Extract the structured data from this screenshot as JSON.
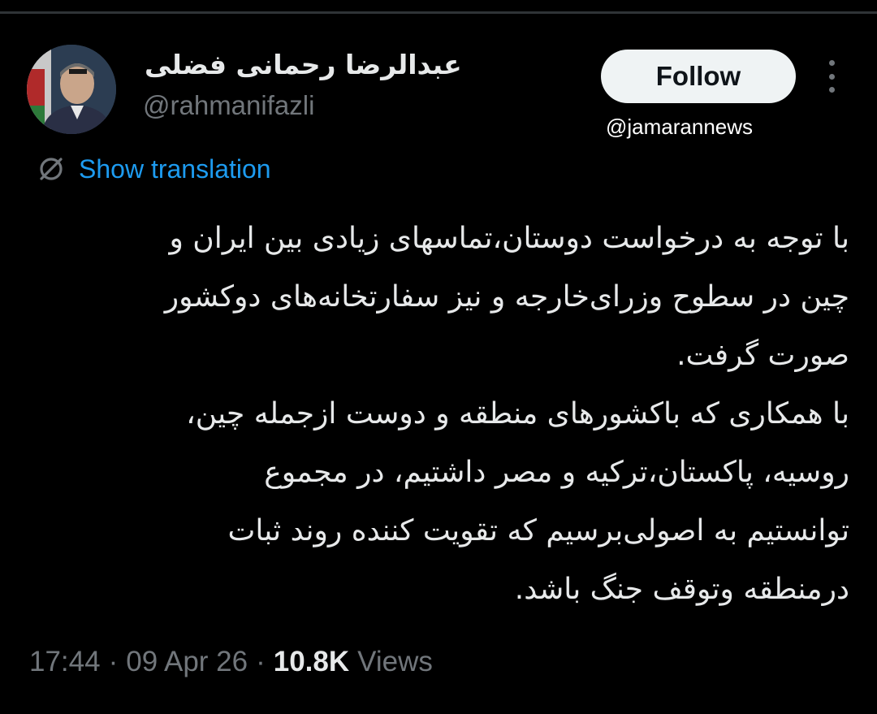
{
  "author": {
    "display_name": "عبدالرضا رحمانی فضلی",
    "handle": "@rahmanifazli"
  },
  "actions": {
    "follow_label": "Follow",
    "more_icon": "more-vertical-icon"
  },
  "watermark": "@jamarannews",
  "translation": {
    "icon": "globe-icon",
    "label": "Show translation"
  },
  "tweet": {
    "lines": [
      "با توجه به درخواست دوستان،تماسهای زیادی بین ایران و",
      "چین در سطوح وزرای‌خارجه و نیز سفارتخانه‌های دوکشور",
      "صورت گرفت.",
      "با همکاری که باکشورهای منطقه و دوست ازجمله چین،",
      "روسیه، پاکستان،ترکیه و مصر داشتیم، در مجموع",
      "توانستیم به اصولی‌برسیم که تقویت کننده روند ثبات",
      "درمنطقه وتوقف جنگ باشد."
    ]
  },
  "meta": {
    "time": "17:44",
    "separator": "·",
    "date": "09 Apr 26",
    "views_count": "10.8K",
    "views_label": "Views"
  },
  "colors": {
    "background": "#000000",
    "text": "#e7e9ea",
    "muted": "#71767b",
    "link": "#1d9bf0",
    "follow_bg": "#eff3f4"
  }
}
